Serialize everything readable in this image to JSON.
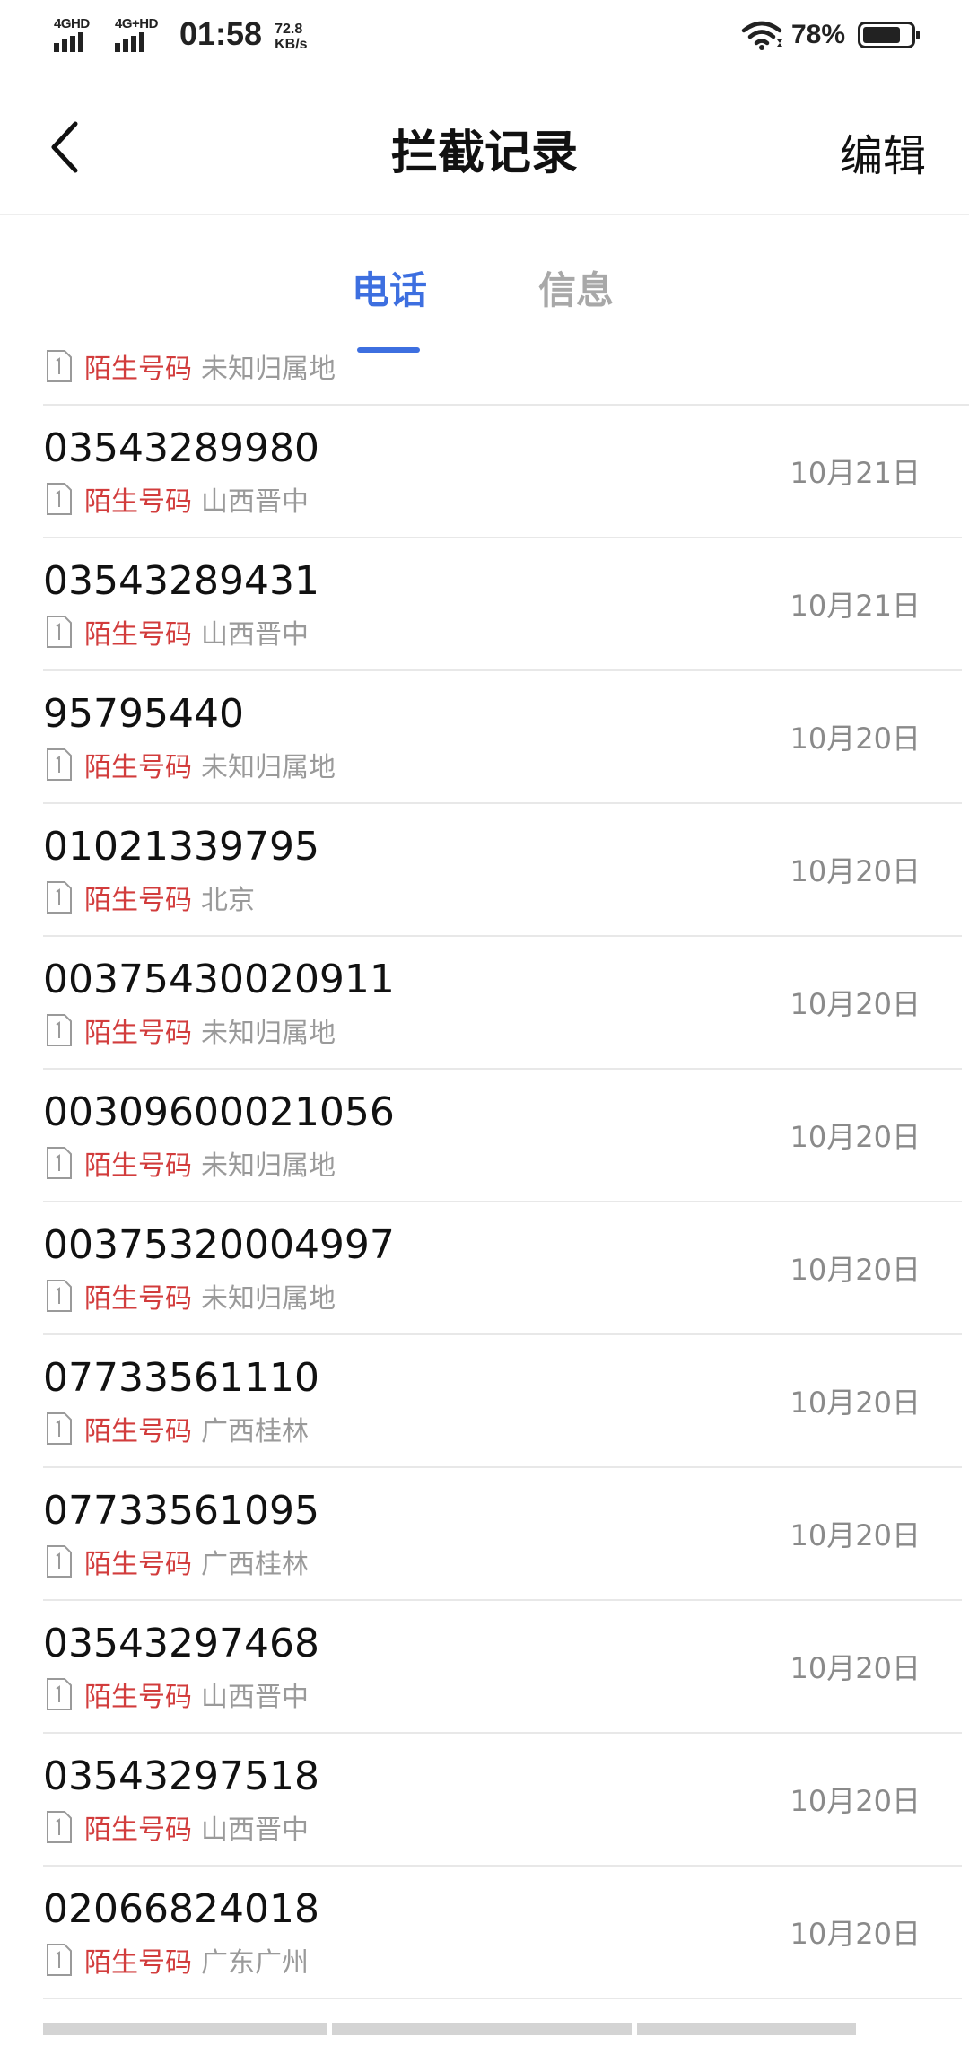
{
  "status_bar": {
    "signal_1_label": "4GHD",
    "signal_2_label": "4G+HD",
    "time": "01:58",
    "speed_value": "72.8",
    "speed_unit": "KB/s",
    "battery_percent": "78%",
    "battery_level": 0.78
  },
  "nav": {
    "back_icon": "chevron-left-icon",
    "title": "拦截记录",
    "edit_label": "编辑"
  },
  "tabs": {
    "calls": "电话",
    "messages": "信息",
    "active": "calls"
  },
  "colors": {
    "accent": "#3d6fe0",
    "tag_red": "#d23c3c",
    "secondary_text": "#9a9a9a"
  },
  "partial_top": {
    "tag": "陌生号码",
    "location": "未知归属地"
  },
  "records": [
    {
      "number": "03543289980",
      "tag": "陌生号码",
      "location": "山西晋中",
      "date": "10月21日"
    },
    {
      "number": "03543289431",
      "tag": "陌生号码",
      "location": "山西晋中",
      "date": "10月21日"
    },
    {
      "number": "95795440",
      "tag": "陌生号码",
      "location": "未知归属地",
      "date": "10月20日"
    },
    {
      "number": "01021339795",
      "tag": "陌生号码",
      "location": "北京",
      "date": "10月20日"
    },
    {
      "number": "00375430020911",
      "tag": "陌生号码",
      "location": "未知归属地",
      "date": "10月20日"
    },
    {
      "number": "00309600021056",
      "tag": "陌生号码",
      "location": "未知归属地",
      "date": "10月20日"
    },
    {
      "number": "00375320004997",
      "tag": "陌生号码",
      "location": "未知归属地",
      "date": "10月20日"
    },
    {
      "number": "07733561110",
      "tag": "陌生号码",
      "location": "广西桂林",
      "date": "10月20日"
    },
    {
      "number": "07733561095",
      "tag": "陌生号码",
      "location": "广西桂林",
      "date": "10月20日"
    },
    {
      "number": "03543297468",
      "tag": "陌生号码",
      "location": "山西晋中",
      "date": "10月20日"
    },
    {
      "number": "03543297518",
      "tag": "陌生号码",
      "location": "山西晋中",
      "date": "10月20日"
    },
    {
      "number": "02066824018",
      "tag": "陌生号码",
      "location": "广东广州",
      "date": "10月20日"
    }
  ]
}
